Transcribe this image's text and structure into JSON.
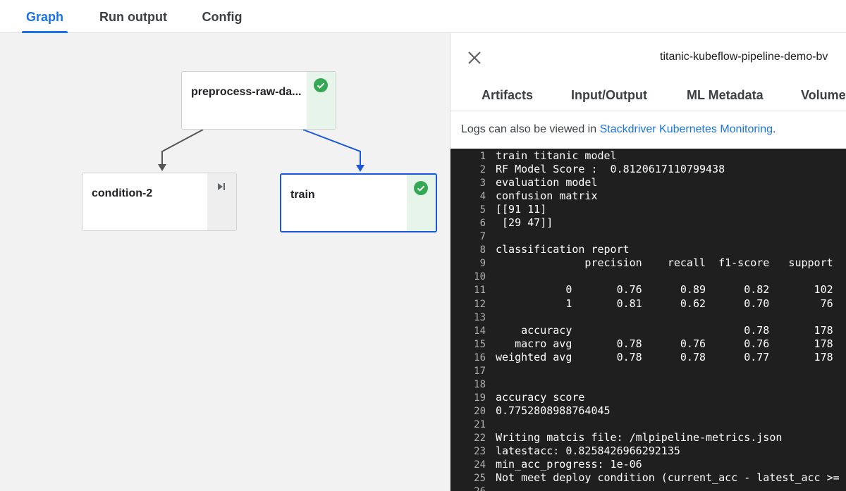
{
  "top_tabs": [
    {
      "label": "Graph",
      "active": true
    },
    {
      "label": "Run output",
      "active": false
    },
    {
      "label": "Config",
      "active": false
    }
  ],
  "graph": {
    "nodes": [
      {
        "label": "preprocess-raw-da...",
        "status": "succeeded"
      },
      {
        "label": "condition-2",
        "status": "skipped"
      },
      {
        "label": "train",
        "status": "succeeded",
        "selected": true
      }
    ]
  },
  "panel": {
    "run_title": "titanic-kubeflow-pipeline-demo-bv",
    "tabs": [
      "Artifacts",
      "Input/Output",
      "ML Metadata",
      "Volume"
    ],
    "logs_note_prefix": "Logs can also be viewed in ",
    "logs_link": "Stackdriver Kubernetes Monitoring",
    "logs_note_suffix": ".",
    "log_lines": [
      {
        "n": "1",
        "t": "train titanic model"
      },
      {
        "n": "2",
        "t": "RF Model Score :  0.8120617110799438"
      },
      {
        "n": "3",
        "t": "evaluation model"
      },
      {
        "n": "4",
        "t": "confusion matrix"
      },
      {
        "n": "5",
        "t": "[[91 11]"
      },
      {
        "n": "6",
        "t": " [29 47]]"
      },
      {
        "n": "7",
        "t": ""
      },
      {
        "n": "8",
        "t": "classification report"
      },
      {
        "n": "9",
        "t": "              precision    recall  f1-score   support"
      },
      {
        "n": "10",
        "t": ""
      },
      {
        "n": "11",
        "t": "           0       0.76      0.89      0.82       102"
      },
      {
        "n": "12",
        "t": "           1       0.81      0.62      0.70        76"
      },
      {
        "n": "13",
        "t": ""
      },
      {
        "n": "14",
        "t": "    accuracy                           0.78       178"
      },
      {
        "n": "15",
        "t": "   macro avg       0.78      0.76      0.76       178"
      },
      {
        "n": "16",
        "t": "weighted avg       0.78      0.78      0.77       178"
      },
      {
        "n": "17",
        "t": ""
      },
      {
        "n": "18",
        "t": ""
      },
      {
        "n": "19",
        "t": "accuracy score"
      },
      {
        "n": "20",
        "t": "0.7752808988764045"
      },
      {
        "n": "21",
        "t": ""
      },
      {
        "n": "22",
        "t": "Writing matcis file: /mlpipeline-metrics.json"
      },
      {
        "n": "23",
        "t": "latestacc: 0.8258426966292135"
      },
      {
        "n": "24",
        "t": "min_acc_progress: 1e-06"
      },
      {
        "n": "25",
        "t": "Not meet deploy condition (current_acc - latest_acc >="
      },
      {
        "n": "26",
        "t": ""
      }
    ]
  },
  "colors": {
    "accent": "#1a73e8",
    "success": "#34a853",
    "log_bg": "#1f1f1f",
    "selected_edge": "#1a56db"
  }
}
